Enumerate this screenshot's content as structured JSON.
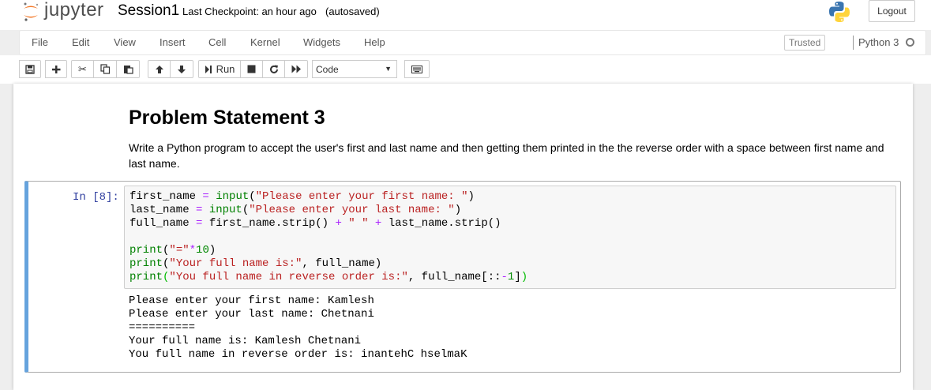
{
  "header": {
    "logo_text": "jupyter",
    "notebook_name": "Session1",
    "checkpoint": "Last Checkpoint: an hour ago",
    "autosave": "(autosaved)",
    "logout_label": "Logout"
  },
  "menu": {
    "items": [
      "File",
      "Edit",
      "View",
      "Insert",
      "Cell",
      "Kernel",
      "Widgets",
      "Help"
    ],
    "trusted": "Trusted",
    "kernel": "Python 3"
  },
  "toolbar": {
    "run_label": "Run",
    "cell_type": "Code",
    "icons": [
      "save-icon",
      "plus-icon",
      "cut-icon",
      "copy-icon",
      "paste-icon",
      "arrow-up-icon",
      "arrow-down-icon",
      "run-icon",
      "stop-icon",
      "restart-icon",
      "fast-forward-icon",
      "keyboard-icon"
    ]
  },
  "markdown": {
    "heading": "Problem Statement 3",
    "paragraph": "Write a Python program to accept the user's first and last name and then getting them printed in the the reverse order with a space between first name and last name."
  },
  "code_cell": {
    "prompt": "In [8]:",
    "output": [
      "Please enter your first name: Kamlesh",
      "Please enter your last name: Chetnani",
      "==========",
      "Your full name is: Kamlesh Chetnani",
      "You full name in reverse order is: inantehC hselmaK"
    ]
  },
  "colors": {
    "selected_cell_border": "#66a3dd",
    "prompt_in": "#303f9f",
    "string": "#ba2121",
    "builtin": "#008000",
    "operator": "#aa22ff"
  }
}
